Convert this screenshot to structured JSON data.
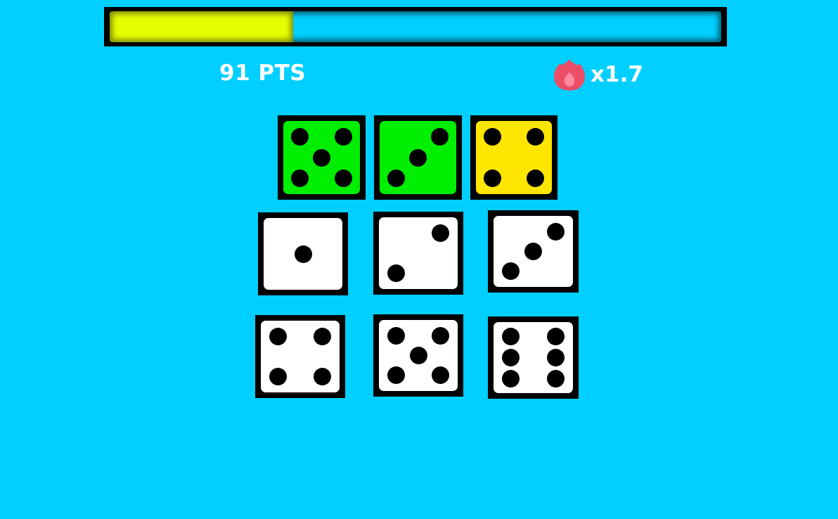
{
  "progress": {
    "fraction": 0.3,
    "fill_color": "#E6FF00",
    "track_color": "#00CFFF"
  },
  "score": {
    "label": "91 PTS"
  },
  "multiplier": {
    "label": "x1.7",
    "icon": "flame-icon"
  },
  "dice": [
    {
      "value": 5,
      "color": "green"
    },
    {
      "value": 3,
      "color": "green"
    },
    {
      "value": 4,
      "color": "yellow"
    },
    {
      "value": 1,
      "color": "white"
    },
    {
      "value": 2,
      "color": "white"
    },
    {
      "value": 3,
      "color": "white"
    },
    {
      "value": 4,
      "color": "white"
    },
    {
      "value": 5,
      "color": "white"
    },
    {
      "value": 6,
      "color": "white"
    }
  ],
  "colors": {
    "background": "#00CFFF",
    "green": "#00EE00",
    "yellow": "#FFE600",
    "white": "#FFFFFF"
  }
}
